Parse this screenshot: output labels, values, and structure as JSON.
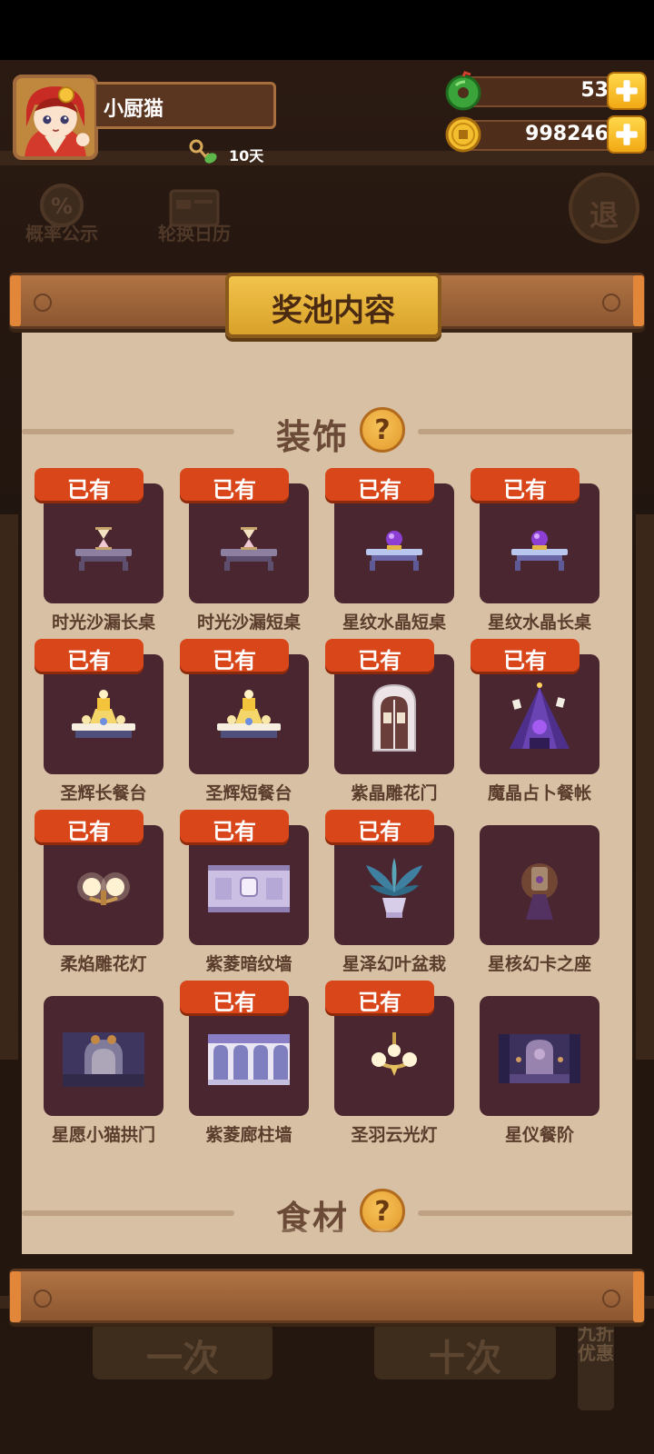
{
  "player": {
    "name": "小厨猫",
    "days": "10天"
  },
  "currencies": {
    "jade": "53",
    "coins": "998246"
  },
  "toolbar": {
    "probability": "概率公示",
    "calendar": "轮换日历",
    "exit": "退"
  },
  "modal": {
    "title": "奖池内容",
    "sections": [
      {
        "title": "装饰",
        "help": "?"
      },
      {
        "title": "食材",
        "help": "?"
      }
    ],
    "owned_label": "已有",
    "items": [
      {
        "name": "时光沙漏长桌",
        "owned": true,
        "icon": "hourglass-table-icon"
      },
      {
        "name": "时光沙漏短桌",
        "owned": true,
        "icon": "hourglass-table-icon"
      },
      {
        "name": "星纹水晶短桌",
        "owned": true,
        "icon": "crystal-table-icon"
      },
      {
        "name": "星纹水晶长桌",
        "owned": true,
        "icon": "crystal-table-icon"
      },
      {
        "name": "圣辉长餐台",
        "owned": true,
        "icon": "holy-buffet-icon"
      },
      {
        "name": "圣辉短餐台",
        "owned": true,
        "icon": "holy-buffet-icon"
      },
      {
        "name": "紫晶雕花门",
        "owned": true,
        "icon": "carved-door-icon"
      },
      {
        "name": "魔晶占卜餐帐",
        "owned": true,
        "icon": "divination-tent-icon"
      },
      {
        "name": "柔焰雕花灯",
        "owned": true,
        "icon": "wall-lamp-icon"
      },
      {
        "name": "紫菱暗纹墙",
        "owned": true,
        "icon": "purple-wall-icon"
      },
      {
        "name": "星泽幻叶盆栽",
        "owned": true,
        "icon": "potted-plant-icon"
      },
      {
        "name": "星核幻卡之座",
        "owned": false,
        "icon": "card-seat-icon"
      },
      {
        "name": "星愿小猫拱门",
        "owned": false,
        "icon": "cat-arch-icon"
      },
      {
        "name": "紫菱廊柱墙",
        "owned": true,
        "icon": "colonnade-wall-icon"
      },
      {
        "name": "圣羽云光灯",
        "owned": true,
        "icon": "chandelier-icon"
      },
      {
        "name": "星仪餐阶",
        "owned": false,
        "icon": "dining-stage-icon"
      }
    ]
  },
  "bottom": {
    "single": "一次",
    "ten": "十次",
    "discount": "九折优惠"
  }
}
